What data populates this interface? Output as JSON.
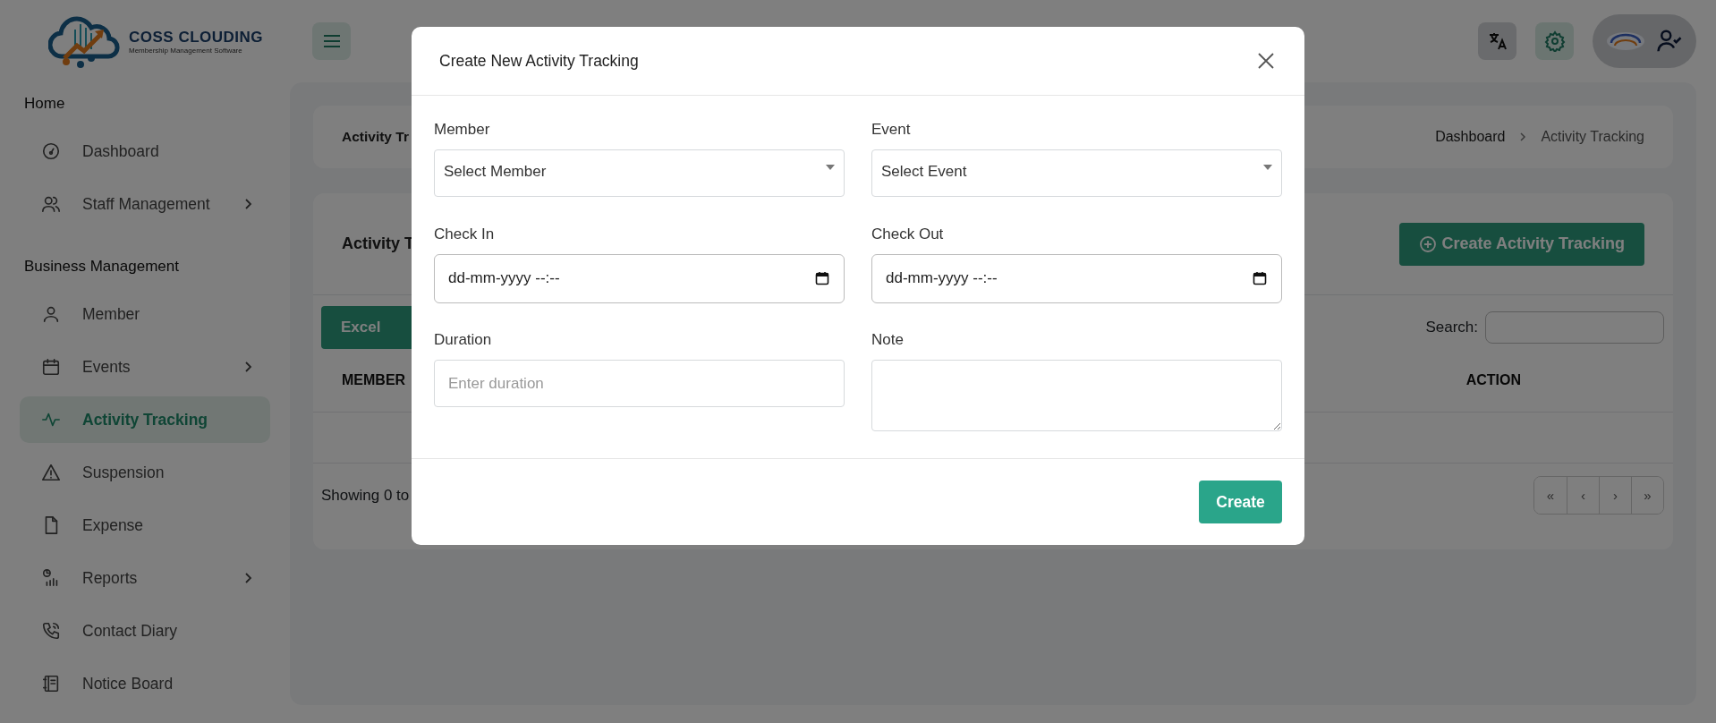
{
  "brand": {
    "name": "COSS CLOUDING",
    "tagline": "Membership Management Software"
  },
  "sidebar": {
    "sections": [
      {
        "heading": "Home",
        "items": [
          {
            "label": "Dashboard",
            "expandable": false,
            "selected": false
          },
          {
            "label": "Staff Management",
            "expandable": true,
            "selected": false
          }
        ]
      },
      {
        "heading": "Business Management",
        "items": [
          {
            "label": "Member",
            "expandable": false,
            "selected": false
          },
          {
            "label": "Events",
            "expandable": true,
            "selected": false
          },
          {
            "label": "Activity Tracking",
            "expandable": false,
            "selected": true
          },
          {
            "label": "Suspension",
            "expandable": false,
            "selected": false
          },
          {
            "label": "Expense",
            "expandable": false,
            "selected": false
          },
          {
            "label": "Reports",
            "expandable": true,
            "selected": false
          },
          {
            "label": "Contact Diary",
            "expandable": false,
            "selected": false
          },
          {
            "label": "Notice Board",
            "expandable": false,
            "selected": false
          }
        ]
      }
    ]
  },
  "breadcrumb": {
    "title": "Activity Tr",
    "trail": [
      "Dashboard",
      "Activity Tracking"
    ]
  },
  "card": {
    "title": "Activity T",
    "create_button": "Create Activity Tracking",
    "export_button": "Excel",
    "search_label": "Search:",
    "columns": [
      "MEMBER",
      "ACTION"
    ],
    "info": "Showing 0 to",
    "pagination": [
      "«",
      "‹",
      "›",
      "»"
    ]
  },
  "modal": {
    "title": "Create New Activity Tracking",
    "fields": [
      {
        "label": "Member",
        "kind": "select",
        "value": "Select Member"
      },
      {
        "label": "Event",
        "kind": "select",
        "value": "Select Event"
      },
      {
        "label": "Check In",
        "kind": "datetime",
        "value": "dd-mm-yyyy --:--"
      },
      {
        "label": "Check Out",
        "kind": "datetime",
        "value": "dd-mm-yyyy --:--"
      },
      {
        "label": "Duration",
        "kind": "text",
        "placeholder": "Enter duration"
      },
      {
        "label": "Note",
        "kind": "textarea"
      }
    ],
    "submit": "Create"
  }
}
